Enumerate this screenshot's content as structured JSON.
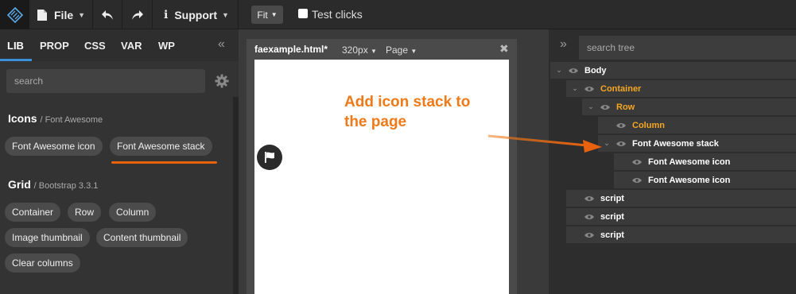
{
  "toolbar": {
    "file_label": "File",
    "support_label": "Support",
    "fit_label": "Fit",
    "test_clicks_label": "Test clicks"
  },
  "left_panel": {
    "tabs": [
      {
        "label": "LIB",
        "active": true
      },
      {
        "label": "PROP",
        "active": false
      },
      {
        "label": "CSS",
        "active": false
      },
      {
        "label": "VAR",
        "active": false
      },
      {
        "label": "WP",
        "active": false
      }
    ],
    "search_placeholder": "search",
    "sections": [
      {
        "title": "Icons",
        "subtitle": "/ Font Awesome",
        "items": [
          "Font Awesome icon",
          "Font Awesome stack"
        ]
      },
      {
        "title": "Grid",
        "subtitle": "/ Bootstrap 3.3.1",
        "items": [
          "Container",
          "Row",
          "Column",
          "Image thumbnail",
          "Content thumbnail",
          "Clear columns"
        ]
      }
    ]
  },
  "canvas": {
    "file_name": "faexample.html*",
    "width_option": "320px",
    "mode_option": "Page",
    "close_glyph": "✖"
  },
  "annotation": {
    "line1": "Add icon stack to",
    "line2": "the page"
  },
  "tree": {
    "search_placeholder": "search tree",
    "nodes": [
      {
        "label": "Body",
        "depth": 0,
        "toggle": "⌄",
        "color": "white"
      },
      {
        "label": "Container",
        "depth": 1,
        "toggle": "⌄",
        "color": "orange"
      },
      {
        "label": "Row",
        "depth": 2,
        "toggle": "⌄",
        "color": "orange"
      },
      {
        "label": "Column",
        "depth": 3,
        "toggle": "",
        "color": "orange"
      },
      {
        "label": "Font Awesome stack",
        "depth": 3,
        "toggle": "⌄",
        "color": "white"
      },
      {
        "label": "Font Awesome icon",
        "depth": 4,
        "toggle": "",
        "color": "white"
      },
      {
        "label": "Font Awesome icon",
        "depth": 4,
        "toggle": "",
        "color": "white"
      },
      {
        "label": "script",
        "depth": 1,
        "toggle": "",
        "color": "white"
      },
      {
        "label": "script",
        "depth": 1,
        "toggle": "",
        "color": "white"
      },
      {
        "label": "script",
        "depth": 1,
        "toggle": "",
        "color": "white"
      }
    ]
  },
  "colors": {
    "accent": "#3b8fd6",
    "highlight": "#e8620e",
    "tree_orange": "#f5a623",
    "annotation": "#f07a1a"
  }
}
